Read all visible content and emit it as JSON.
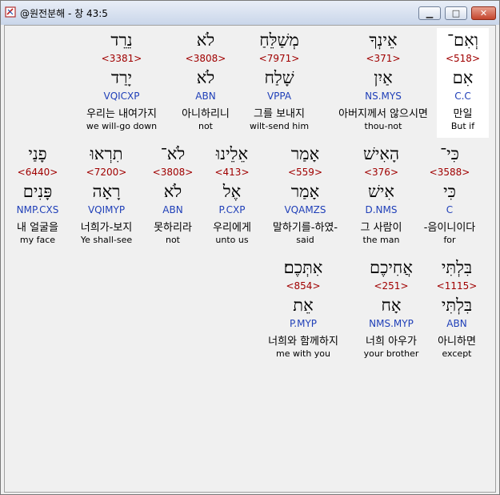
{
  "window": {
    "title": "@원전분해 - 창 43:5"
  },
  "rows": [
    [
      {
        "hebrew": "וְאִם־",
        "strong": "<518>",
        "lemma": "אִם",
        "parse": "C.C",
        "korean": "만일",
        "english": "But if",
        "selected": true
      },
      {
        "hebrew": "אֵינְךָ",
        "strong": "<371>",
        "lemma": "אַיִן",
        "parse": "NS.MYS",
        "korean": "아버지께서 않으시면",
        "english": "thou-not"
      },
      {
        "hebrew": "מְשַׁלֵּחַ",
        "strong": "<7971>",
        "lemma": "שָׁלַח",
        "parse": "VPPA",
        "korean": "그를 보내지",
        "english": "wilt-send him"
      },
      {
        "hebrew": "לֹא",
        "strong": "<3808>",
        "lemma": "לֹא",
        "parse": "ABN",
        "korean": "아니하리니",
        "english": "not"
      },
      {
        "hebrew": "נֵרֵד",
        "strong": "<3381>",
        "lemma": "יָרַד",
        "parse": "VQICXP",
        "korean": "우리는 내여가지",
        "english": "we will-go down"
      }
    ],
    [
      {
        "hebrew": "כִּי־",
        "strong": "<3588>",
        "lemma": "כִּי",
        "parse": "C",
        "korean": "-음이니이다",
        "english": "for"
      },
      {
        "hebrew": "הָאִישׁ",
        "strong": "<376>",
        "lemma": "אִישׁ",
        "parse": "D.NMS",
        "korean": "그 사람이",
        "english": "the man"
      },
      {
        "hebrew": "אָמַר",
        "strong": "<559>",
        "lemma": "אָמַר",
        "parse": "VQAMZS",
        "korean": "말하기를-하였-",
        "english": "said"
      },
      {
        "hebrew": "אֵלֵינוּ",
        "strong": "<413>",
        "lemma": "אֶל",
        "parse": "P.CXP",
        "korean": "우리에게",
        "english": "unto us"
      },
      {
        "hebrew": "לֹא־",
        "strong": "<3808>",
        "lemma": "לֹא",
        "parse": "ABN",
        "korean": "못하리라",
        "english": "not"
      },
      {
        "hebrew": "תִרְאוּ",
        "strong": "<7200>",
        "lemma": "רָאָה",
        "parse": "VQIMYP",
        "korean": "너희가-보지",
        "english": "Ye shall-see"
      },
      {
        "hebrew": "פָנַי",
        "strong": "<6440>",
        "lemma": "פָּנִים",
        "parse": "NMP.CXS",
        "korean": "내 얼굴을",
        "english": "my face"
      }
    ],
    [
      {
        "hebrew": "בִּלְתִּי",
        "strong": "<1115>",
        "lemma": "בִּלְתִּי",
        "parse": "ABN",
        "korean": "아니하면",
        "english": "except"
      },
      {
        "hebrew": "אֲחִיכֶם",
        "strong": "<251>",
        "lemma": "אָח",
        "parse": "NMS.MYP",
        "korean": "너희 아우가",
        "english": "your brother"
      },
      {
        "hebrew": "אִתְּכֶם׃",
        "strong": "<854>",
        "lemma": "אֵת",
        "parse": "P.MYP",
        "korean": "너희와 함께하지",
        "english": "me with you"
      }
    ]
  ]
}
